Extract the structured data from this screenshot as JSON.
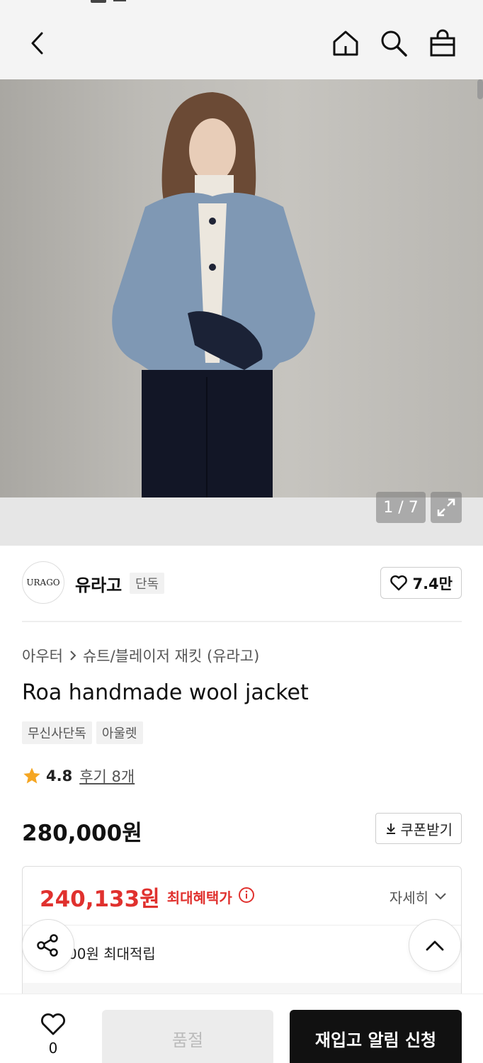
{
  "nav": {
    "back_icon": "chevron-left-icon",
    "home_icon": "home-icon",
    "search_icon": "search-icon",
    "cart_icon": "shopping-bag-icon"
  },
  "gallery": {
    "counter": "1 / 7",
    "expand_icon": "expand-icon"
  },
  "brand": {
    "logo_text": "URAGO",
    "name": "유라고",
    "badge": "단독",
    "likes": "7.4만"
  },
  "breadcrumb": {
    "level1": "아우터",
    "level2": "슈트/블레이저 재킷 (유라고)"
  },
  "product": {
    "title": "Roa handmade wool jacket",
    "tags": [
      "무신사단독",
      "아울렛"
    ],
    "rating": "4.8",
    "reviews": "후기 8개",
    "price": "280,000원",
    "coupon_label": "쿠폰받기"
  },
  "benefit": {
    "max_price": "240,133원",
    "max_label": "최대혜택가",
    "detail_label": "자세히",
    "points_text": "00원 최대적립"
  },
  "bottom": {
    "wish_count": "0",
    "soldout_label": "품절",
    "restock_label": "재입고 알림 신청"
  },
  "colors": {
    "accent_red": "#e0312e",
    "primary_black": "#111111",
    "soldout_gray": "#ececec"
  }
}
